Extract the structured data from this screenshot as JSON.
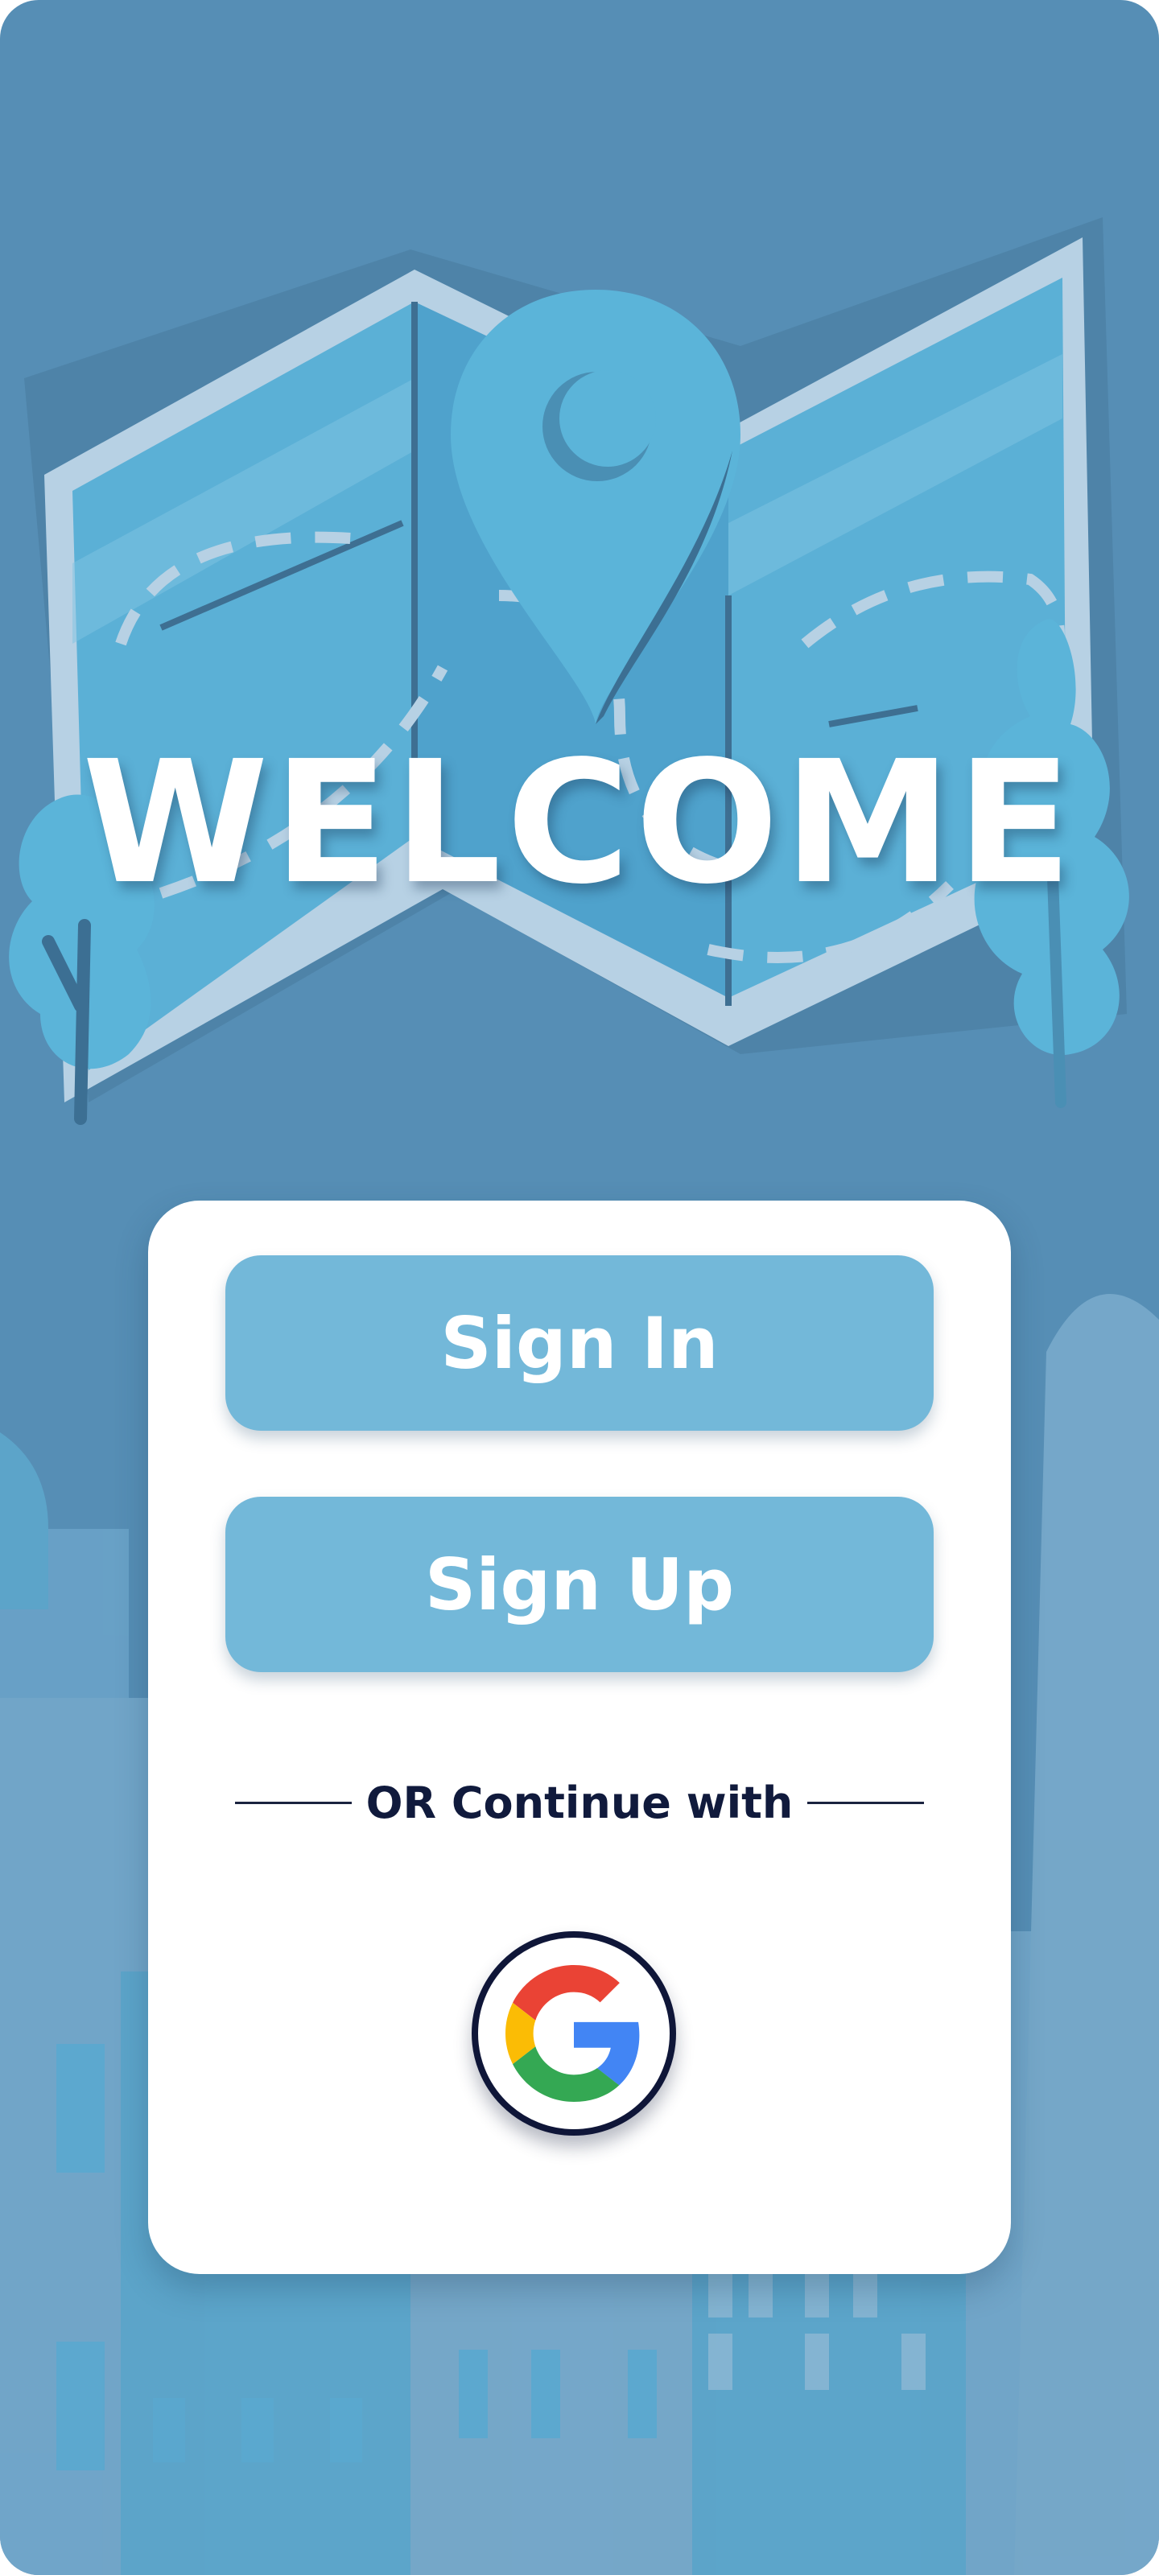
{
  "screen": {
    "title": "WELCOME"
  },
  "actions": {
    "sign_in_label": "Sign In",
    "sign_up_label": "Sign Up",
    "divider_label": "OR Continue with",
    "google_icon": "google-g-icon"
  },
  "colors": {
    "background": "#568eb5",
    "button": "#73b8d9",
    "card": "#ffffff",
    "accent_dark": "#0f1638"
  }
}
